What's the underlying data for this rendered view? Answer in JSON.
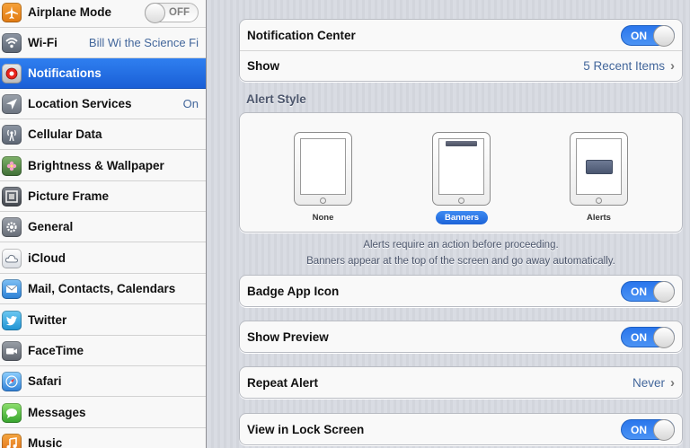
{
  "sidebar": {
    "items": [
      {
        "label": "Airplane Mode",
        "switch": "OFF"
      },
      {
        "label": "Wi-Fi",
        "value": "Bill Wi the Science Fi"
      },
      {
        "label": "Notifications"
      },
      {
        "label": "Location Services",
        "value": "On"
      },
      {
        "label": "Cellular Data"
      },
      {
        "label": "Brightness & Wallpaper"
      },
      {
        "label": "Picture Frame"
      },
      {
        "label": "General"
      },
      {
        "label": "iCloud"
      },
      {
        "label": "Mail, Contacts, Calendars"
      },
      {
        "label": "Twitter"
      },
      {
        "label": "FaceTime"
      },
      {
        "label": "Safari"
      },
      {
        "label": "Messages"
      },
      {
        "label": "Music"
      }
    ]
  },
  "main": {
    "notification_center": {
      "label": "Notification Center",
      "toggle": "ON"
    },
    "show": {
      "label": "Show",
      "value": "5 Recent Items"
    },
    "alert_style": {
      "header": "Alert Style",
      "options": [
        {
          "label": "None"
        },
        {
          "label": "Banners"
        },
        {
          "label": "Alerts"
        }
      ],
      "selected": "Banners"
    },
    "footnote_line1": "Alerts require an action before proceeding.",
    "footnote_line2": "Banners appear at the top of the screen and go away automatically.",
    "badge_app_icon": {
      "label": "Badge App Icon",
      "toggle": "ON"
    },
    "show_preview": {
      "label": "Show Preview",
      "toggle": "ON"
    },
    "repeat_alert": {
      "label": "Repeat Alert",
      "value": "Never"
    },
    "view_in_lock_screen": {
      "label": "View in Lock Screen",
      "toggle": "ON"
    }
  },
  "colors": {
    "selection_blue": "#1a5fd6",
    "toggle_on_blue": "#2a76ec",
    "value_text": "#42669b"
  }
}
